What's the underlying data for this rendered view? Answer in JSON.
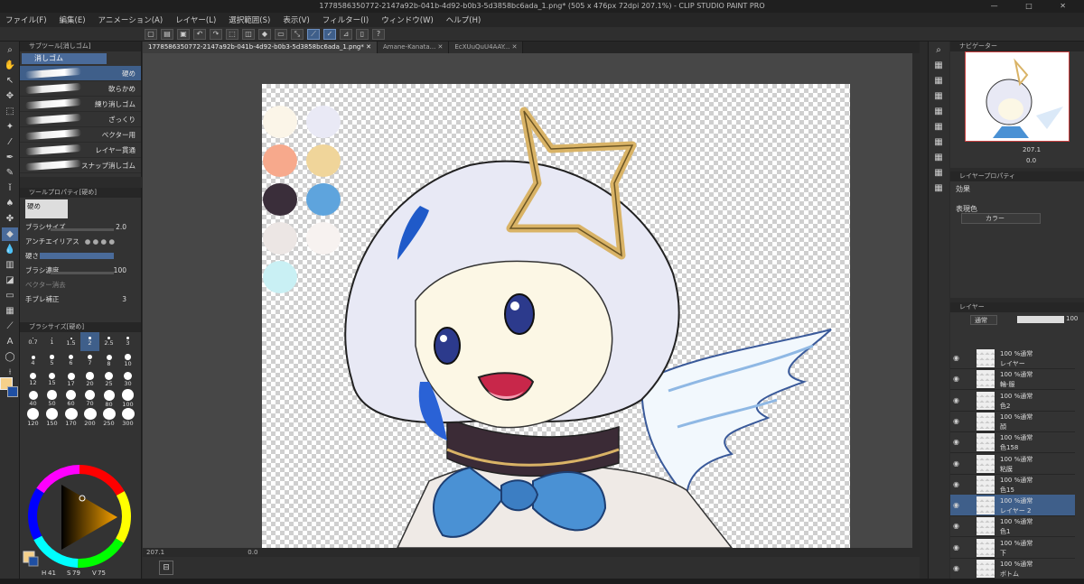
{
  "window": {
    "title": "1778586350772-2147a92b-041b-4d92-b0b3-5d3858bc6ada_1.png* (505 x 476px 72dpi 207.1%)  - CLIP STUDIO PAINT PRO",
    "controls": [
      "—",
      "□",
      "✕"
    ]
  },
  "menu": [
    "ファイル(F)",
    "編集(E)",
    "アニメーション(A)",
    "レイヤー(L)",
    "選択範囲(S)",
    "表示(V)",
    "フィルター(I)",
    "ウィンドウ(W)",
    "ヘルプ(H)"
  ],
  "tabs": [
    {
      "label": "1778586350772-2147a92b-041b-4d92-b0b3-5d3858bc6ada_1.png*",
      "active": true
    },
    {
      "label": "Amane-Kanata...",
      "active": false
    },
    {
      "label": "EcXUuQuU4AAY...",
      "active": false
    }
  ],
  "subtool": {
    "panel_title": "サブツール[消しゴム]",
    "group": "消しゴム",
    "brushes": [
      "硬め",
      "軟らかめ",
      "練り消しゴム",
      "ざっくり",
      "ベクター用",
      "レイヤー貫通",
      "スナップ消しゴム"
    ],
    "selected": 0
  },
  "tool_property": {
    "panel_title": "ツールプロパティ[硬め]",
    "preset": "硬め",
    "rows": [
      {
        "label": "ブラシサイズ",
        "value": "2.0"
      },
      {
        "label": "アンチエイリアス",
        "value": ""
      },
      {
        "label": "硬さ",
        "value": ""
      },
      {
        "label": "ブラシ濃度",
        "value": "100"
      },
      {
        "label": "ベクター消去",
        "value": ""
      },
      {
        "label": "手ブレ補正",
        "value": "3"
      }
    ]
  },
  "brush_size": {
    "panel_title": "ブラシサイズ[硬め]",
    "sizes": [
      "0.7",
      "1",
      "1.5",
      "2",
      "2.5",
      "3",
      "4",
      "5",
      "6",
      "7",
      "8",
      "10",
      "12",
      "15",
      "17",
      "20",
      "25",
      "30",
      "40",
      "50",
      "60",
      "70",
      "80",
      "100",
      "120",
      "150",
      "170",
      "200",
      "250",
      "300"
    ],
    "selected": "2"
  },
  "color": {
    "main": "#f5d08a",
    "sub": "#1f4fa3",
    "h_value": "41",
    "s_value": "79",
    "v_value": "75"
  },
  "palette": [
    "#fbf5e8",
    "#e9e9f5",
    "#f7a98c",
    "#f0d59a",
    "#3a2e3a",
    "#5ea4dd",
    "#ece6e4",
    "#f7f2f0",
    "#c9f0f4"
  ],
  "status": {
    "zoom": "207.1",
    "angle": "0.0"
  },
  "navigator": {
    "panel_title": "ナビゲーター",
    "zoom": "207.1",
    "angle": "0.0"
  },
  "layer_property": {
    "panel_title": "レイヤープロパティ",
    "effect_label": "効果",
    "express_label": "表現色",
    "express_value": "カラー"
  },
  "layers_panel": {
    "panel_title": "レイヤー",
    "blend": "通常",
    "opacity": "100",
    "items": [
      {
        "opacity": "100 %通常",
        "name": "レイヤー",
        "active": false
      },
      {
        "opacity": "100 %通常",
        "name": "輪-服",
        "active": false
      },
      {
        "opacity": "100 %通常",
        "name": "色2",
        "active": false
      },
      {
        "opacity": "100 %通常",
        "name": "顔",
        "active": false
      },
      {
        "opacity": "100 %通常",
        "name": "色158",
        "active": false
      },
      {
        "opacity": "100 %通常",
        "name": "粘膜",
        "active": false
      },
      {
        "opacity": "100 %通常",
        "name": "色15",
        "active": false
      },
      {
        "opacity": "100 %通常",
        "name": "レイヤー 2",
        "active": true
      },
      {
        "opacity": "100 %通常",
        "name": "色1",
        "active": false
      },
      {
        "opacity": "100 %通常",
        "name": "下",
        "active": false
      },
      {
        "opacity": "100 %通常",
        "name": "ボトム",
        "active": false
      }
    ]
  }
}
